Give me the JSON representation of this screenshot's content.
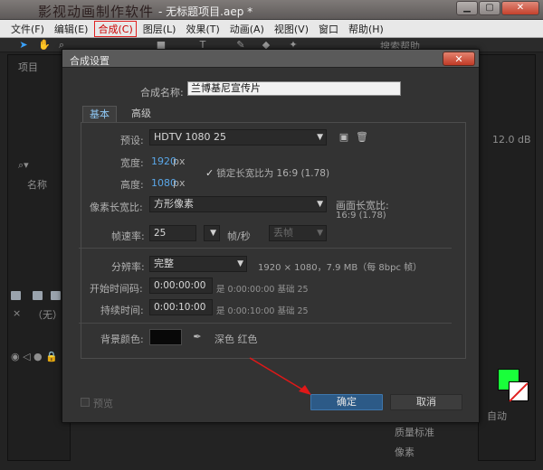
{
  "window": {
    "watermark": "影视动画制作软件",
    "title": "- 无标题项目.aep *",
    "minimize": "▁",
    "maximize": "▢",
    "close": "✕"
  },
  "menu": [
    "文件(F)",
    "编辑(E)",
    "合成(C)",
    "图层(L)",
    "效果(T)",
    "动画(A)",
    "视图(V)",
    "窗口",
    "帮助(H)"
  ],
  "toolbar": {
    "search_help": "搜索帮助"
  },
  "background": {
    "project_label": "项目",
    "name_column": "名称",
    "none_label": "（无）",
    "db_value": "12.0 dB",
    "auto_label": "自动",
    "quality_label": "质量标准",
    "pixel_label": "像素",
    "accent_color": "#19ff3a"
  },
  "dialog": {
    "title": "合成设置",
    "close": "✕",
    "comp_name_label": "合成名称:",
    "comp_name": "兰博基尼宣传片",
    "tabs": {
      "basic": "基本",
      "advanced": "高级"
    },
    "preset_label": "预设:",
    "preset_value": "HDTV 1080 25",
    "width_label": "宽度:",
    "width_value": "1920",
    "width_unit": "px",
    "height_label": "高度:",
    "height_value": "1080",
    "height_unit": "px",
    "lock_aspect": "锁定长宽比为 16:9 (1.78)",
    "pixel_aspect_label": "像素长宽比:",
    "pixel_aspect_value": "方形像素",
    "frame_aspect_label": "画面长宽比:",
    "frame_aspect_value": "16:9 (1.78)",
    "frame_rate_label": "帧速率:",
    "frame_rate_value": "25",
    "frame_rate_unit": "帧/秒",
    "drop_frame": "丢帧",
    "resolution_label": "分辨率:",
    "resolution_value": "完整",
    "resolution_info": "1920 × 1080，7.9 MB（每 8bpc 帧）",
    "start_timecode_label": "开始时间码:",
    "start_timecode": "0:00:00:00",
    "start_timecode_info": "是 0:00:00:00  基础 25",
    "duration_label": "持续时间:",
    "duration": "0:00:10:00",
    "duration_info": "是 0:00:10:00  基础 25",
    "bg_color_label": "背景颜色:",
    "bg_color_name": "深色 红色",
    "bg_color": "#080808",
    "preview_label": "预览",
    "ok_label": "确定",
    "cancel_label": "取消",
    "ok_color": "#2c5a87"
  }
}
